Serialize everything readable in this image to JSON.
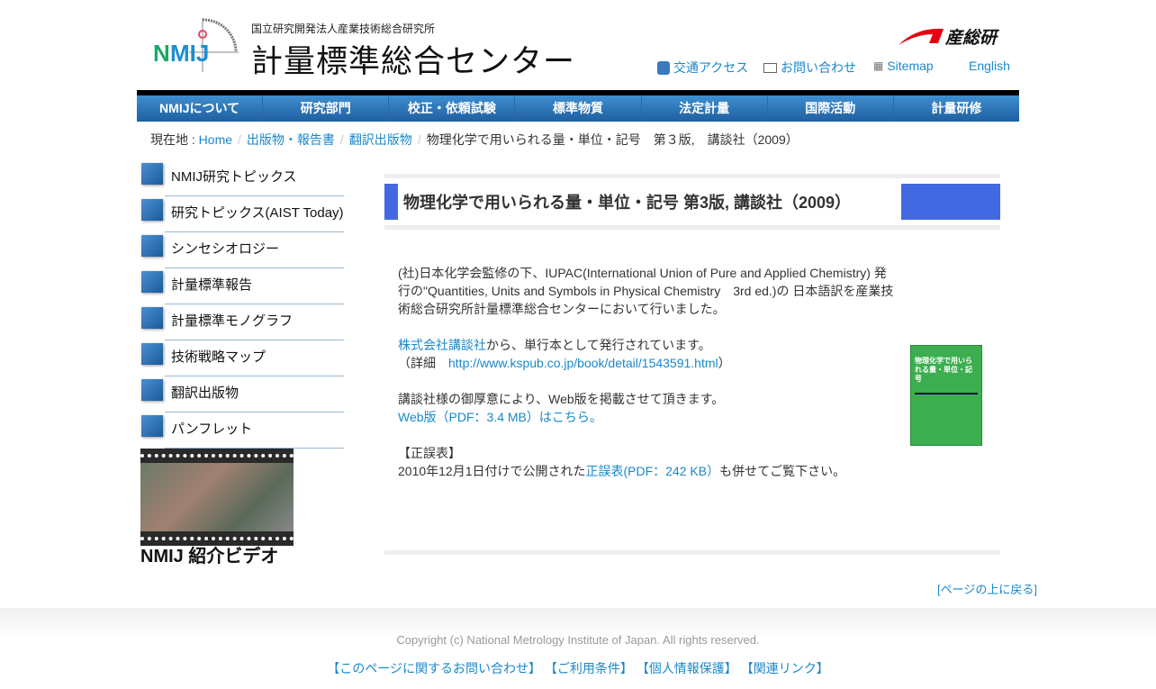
{
  "header": {
    "org": "国立研究開発法人産業技術総合研究所",
    "center": "計量標準総合センター",
    "logo_text": "NMIJ",
    "aist_logo": "産総研",
    "links": [
      {
        "label": "交通アクセス",
        "icon": "bus-icon"
      },
      {
        "label": "お問い合わせ",
        "icon": "mail-icon"
      },
      {
        "label": "Sitemap",
        "icon": "sitemap-icon"
      },
      {
        "label": "English"
      }
    ]
  },
  "nav": [
    "NMIJについて",
    "研究部門",
    "校正・依頼試験",
    "標準物質",
    "法定計量",
    "国際活動",
    "計量研修"
  ],
  "breadcrumb": {
    "prefix": "現在地 : ",
    "items": [
      "Home",
      "出版物・報告書",
      "翻訳出版物"
    ],
    "current": "物理化学で用いられる量・単位・記号　第３版,　講談社（2009）"
  },
  "sidebar": [
    "NMIJ研究トピックス",
    "研究トピックス(AIST Today)",
    "シンセシオロジー",
    "計量標準報告",
    "計量標準モノグラフ",
    "技術戦略マップ",
    "翻訳出版物",
    "パンフレット"
  ],
  "video_banner": "NMIJ 紹介ビデオ",
  "main": {
    "title": "物理化学で用いられる量・単位・記号 第3版, 講談社（2009）",
    "p1": "(社)日本化学会監修の下、IUPAC(International Union of Pure and Applied Chemistry) 発行の\"Quantities, Units and Symbols in Physical Chemistry　3rd ed.)の 日本語訳を産業技術総合研究所計量標準総合センターにおいて行いました。",
    "p2_link": "株式会社講談社",
    "p2_text": "から、単行本として発行されています。",
    "p2_detail": "（詳細　",
    "p2_url": "http://www.kspub.co.jp/book/detail/1543591.html",
    "p2_close": "）",
    "p3_text": "講談社様の御厚意により、Web版を掲載させて頂きます。",
    "p3_link": "Web版（PDF：3.4 MB）はこちら。",
    "p4_head": "【正誤表】",
    "p4_pre": "2010年12月1日付けで公開された",
    "p4_link": "正誤表(PDF：242 KB）",
    "p4_post": "も併せてご覧下さい。",
    "book_cover": "物理化学で用いられる量・単位・記号"
  },
  "to_top": "[ページの上に戻る]",
  "footer": {
    "copyright": "Copyright (c) National Metrology Institute of Japan. All rights reserved.",
    "links": [
      "【このページに関するお問い合わせ】",
      "【ご利用条件】",
      "【個人情報保護】",
      "【関連リンク】"
    ]
  }
}
